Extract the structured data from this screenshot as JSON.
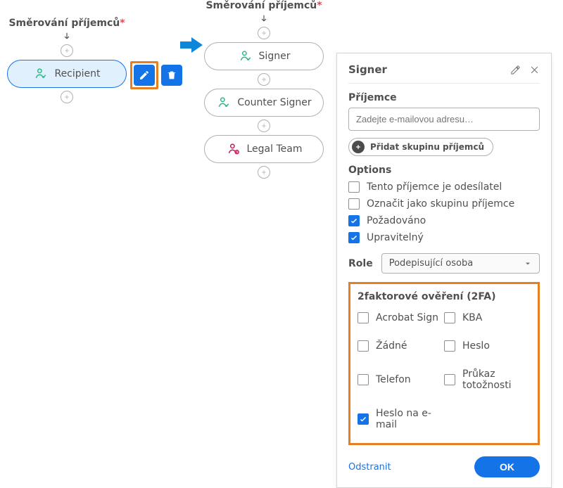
{
  "flow1": {
    "title": "Směrování příjemců",
    "items": [
      "Recipient"
    ]
  },
  "flow2": {
    "title": "Směrování příjemců",
    "items": [
      "Signer",
      "Counter Signer",
      "Legal Team"
    ]
  },
  "panel": {
    "title": "Signer",
    "recipient_label": "Příjemce",
    "recipient_placeholder": "Zadejte e-mailovou adresu…",
    "add_group": "Přidat skupinu příjemců",
    "options_label": "Options",
    "options": {
      "is_sender": "Tento příjemce je odesílatel",
      "as_group": "Označit jako skupinu příjemce",
      "required": "Požadováno",
      "editable": "Upravitelný"
    },
    "role_label": "Role",
    "role_value": "Podepisující osoba",
    "twofa_label": "2faktorové ověření (2FA)",
    "twofa": {
      "acrobat": "Acrobat Sign",
      "kba": "KBA",
      "none": "Žádné",
      "password": "Heslo",
      "phone": "Telefon",
      "id": "Průkaz totožnosti",
      "email_pwd": "Heslo na e-mail"
    },
    "delete": "Odstranit",
    "ok": "OK"
  }
}
